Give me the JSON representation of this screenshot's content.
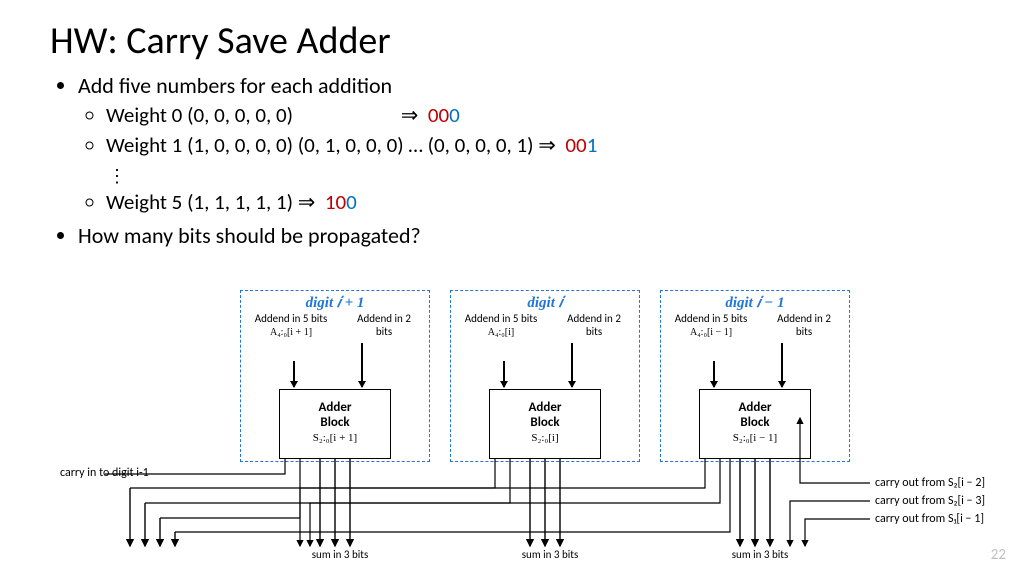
{
  "title": "HW: Carry Save Adder",
  "bullet1": "Add five numbers for each addition",
  "w0_label": "Weight 0 (0, 0, 0, 0, 0)",
  "w0_arrow": "⇒",
  "w0_red": "00",
  "w0_blue": "0",
  "w1_label": "Weight 1 (1, 0, 0, 0, 0) (0, 1, 0, 0, 0) … (0, 0, 0, 0, 1) ",
  "w1_arrow": "⇒",
  "w1_red": "00",
  "w1_blue": "1",
  "vdots": "⋮",
  "w5_label": "Weight 5 (1, 1, 1, 1, 1) ",
  "w5_arrow": "⇒",
  "w5_red": "10",
  "w5_blue": "0",
  "bullet2": "How many bits should be propagated?",
  "pagenum": "22",
  "diagram": {
    "stages": [
      {
        "digit": "digit 𝑖 + 1",
        "addend5": "Addend in 5 bits",
        "addend5_sub": "A₄:₀[i + 1]",
        "addend2": "Addend in 2 bits",
        "block_t": "Adder",
        "block_b": "Block",
        "block_s": "S₂:₀[i + 1]"
      },
      {
        "digit": "digit 𝑖",
        "addend5": "Addend in 5 bits",
        "addend5_sub": "A₄:₀[i]",
        "addend2": "Addend in 2 bits",
        "block_t": "Adder",
        "block_b": "Block",
        "block_s": "S₂:₀[i]"
      },
      {
        "digit": "digit 𝑖 − 1",
        "addend5": "Addend in 5 bits",
        "addend5_sub": "A₄:₀[i − 1]",
        "addend2": "Addend in 2 bits",
        "block_t": "Adder",
        "block_b": "Block",
        "block_s": "S₂:₀[i − 1]"
      }
    ],
    "sum_label": "sum in 3 bits",
    "carry_in_label": "carry in to digit i-1",
    "carry_out1": "carry out from S₂[i − 2]",
    "carry_out2": "carry out from S₂[i − 3]",
    "carry_out3": "carry out from S₁[i − 1]"
  }
}
